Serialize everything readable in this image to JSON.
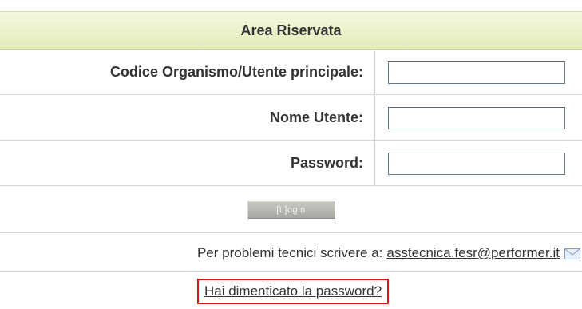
{
  "header": {
    "title": "Area Riservata"
  },
  "fields": [
    {
      "label": "Codice Organismo/Utente principale:",
      "value": "",
      "placeholder": ""
    },
    {
      "label": "Nome Utente:",
      "value": "",
      "placeholder": ""
    },
    {
      "label": "Password:",
      "value": "",
      "placeholder": ""
    }
  ],
  "login_button": {
    "label": "[L]ogin"
  },
  "support": {
    "text": "Per problemi tecnici scrivere a:",
    "email": "asstecnica.fesr@performer.it",
    "icon": "mail-icon"
  },
  "forgot": {
    "label": "Hai dimenticato la password?",
    "highlight_color": "#d01a1a"
  },
  "colors": {
    "header_bg": "#eef2cf",
    "border": "#d4d4d4"
  }
}
